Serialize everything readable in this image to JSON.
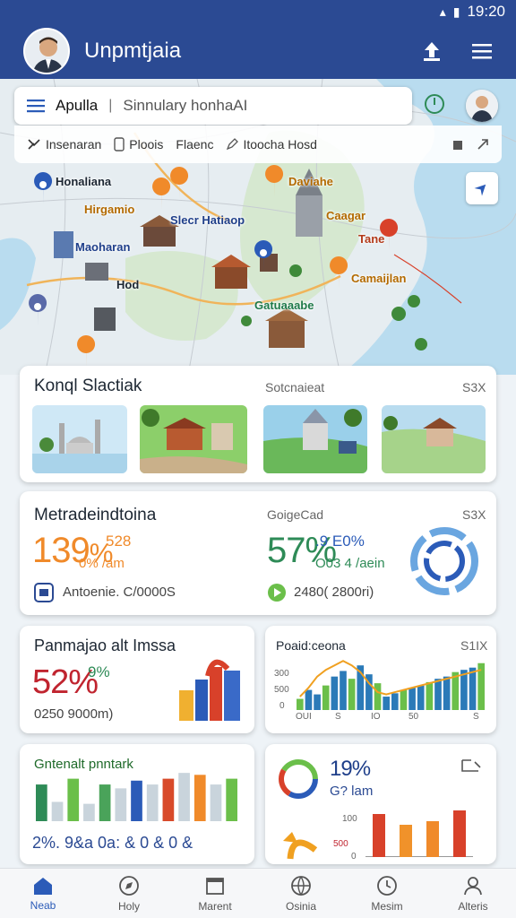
{
  "status_bar": {
    "time": "19:20"
  },
  "app_bar": {
    "title": "Unpmtjaia"
  },
  "search": {
    "text": "Apulla",
    "subtext": "Sinnulary honhaAI"
  },
  "filters": [
    {
      "label": "Insenaran",
      "icon": "route-icon"
    },
    {
      "label": "Ploois",
      "icon": "phone-icon"
    },
    {
      "label": "Flaenc",
      "icon": ""
    },
    {
      "label": "Itoocha Hosd",
      "icon": "pencil-icon"
    }
  ],
  "map_labels": [
    {
      "text": "Honaliana",
      "color": "#1f3f8a"
    },
    {
      "text": "Hirgamio",
      "color": "#b36a00"
    },
    {
      "text": "Slecr Hatiaop",
      "color": "#1f3f8a"
    },
    {
      "text": "Daviahe",
      "color": "#b36a00"
    },
    {
      "text": "Caagar",
      "color": "#b36a00"
    },
    {
      "text": "Tane",
      "color": "#b33a1a"
    },
    {
      "text": "Maoharan",
      "color": "#1f3f8a"
    },
    {
      "text": "Hod",
      "color": "#333"
    },
    {
      "text": "Camaijlan",
      "color": "#b36a00"
    },
    {
      "text": "Gatuaaabe",
      "color": "#1f7a4a"
    }
  ],
  "card1": {
    "title": "Konql Slactiak",
    "tag": "Sotcnaieat",
    "close": "S3X"
  },
  "card2": {
    "title": "Metradeindtoina",
    "left_big": "139",
    "left_small": "%",
    "left_fig": "528",
    "left_sub": "0% /am",
    "right_label": "GoigeCad",
    "close": "S3X",
    "right_big": "57%",
    "right_fig": ".9 E0%",
    "right_sub": "O03 4 /aein",
    "footer_left": "Antoenie. C/0000S",
    "footer_right": "2480( 2800ri)"
  },
  "card3": {
    "title": "Panmajao alt Imssa",
    "big": "52%",
    "small": "9%",
    "sub": "0250 9000m)"
  },
  "card4": {
    "title": "Poaid:ceona",
    "close": "S1IX",
    "y_ticks": [
      "300",
      "500",
      "0"
    ],
    "x_ticks": [
      "OUI",
      "S",
      "IO",
      "50",
      "S"
    ],
    "chart_data": {
      "type": "bar",
      "values": [
        10,
        18,
        14,
        22,
        30,
        35,
        28,
        40,
        32,
        24,
        12,
        15,
        18,
        20,
        22,
        25,
        28,
        30,
        34,
        36,
        38,
        42
      ],
      "line": [
        12,
        20,
        30,
        36,
        40,
        44,
        40,
        34,
        24,
        16,
        14,
        16,
        18,
        20,
        22,
        24,
        26,
        28,
        30,
        32,
        34,
        36
      ]
    }
  },
  "card5": {
    "title": "Gntenalt pnntark",
    "footer": "2%. 9&a 0a: & 0 & 0 &",
    "chart_data": {
      "type": "bar",
      "values": [
        38,
        20,
        44,
        18,
        38,
        34,
        42,
        38,
        44,
        50,
        48,
        38,
        44
      ],
      "colors": [
        "#2e8b57",
        "#c9d4dc",
        "#6bbf4a",
        "#c9d4dc",
        "#4aa35a",
        "#c9d4dc",
        "#2b5bb8",
        "#c9d4dc",
        "#d84a2a",
        "#c9d4dc",
        "#f08a2a",
        "#c9d4dc",
        "#6bbf4a"
      ]
    }
  },
  "card6": {
    "big": "19%",
    "sub": "G? lam",
    "y_ticks": [
      "100",
      "500",
      "0"
    ],
    "chart_data": {
      "type": "bar",
      "values": [
        48,
        36,
        40,
        52
      ],
      "colors": [
        "#d8412a",
        "#f0922a",
        "#f08a2a",
        "#d8412a"
      ]
    }
  },
  "bottom_nav": [
    {
      "label": "Neab",
      "icon": "home-icon",
      "active": true
    },
    {
      "label": "Holy",
      "icon": "compass-icon",
      "active": false
    },
    {
      "label": "Marent",
      "icon": "calendar-icon",
      "active": false
    },
    {
      "label": "Osinia",
      "icon": "globe-icon",
      "active": false
    },
    {
      "label": "Mesim",
      "icon": "clock-icon",
      "active": false
    },
    {
      "label": "Alteris",
      "icon": "user-icon",
      "active": false
    }
  ]
}
